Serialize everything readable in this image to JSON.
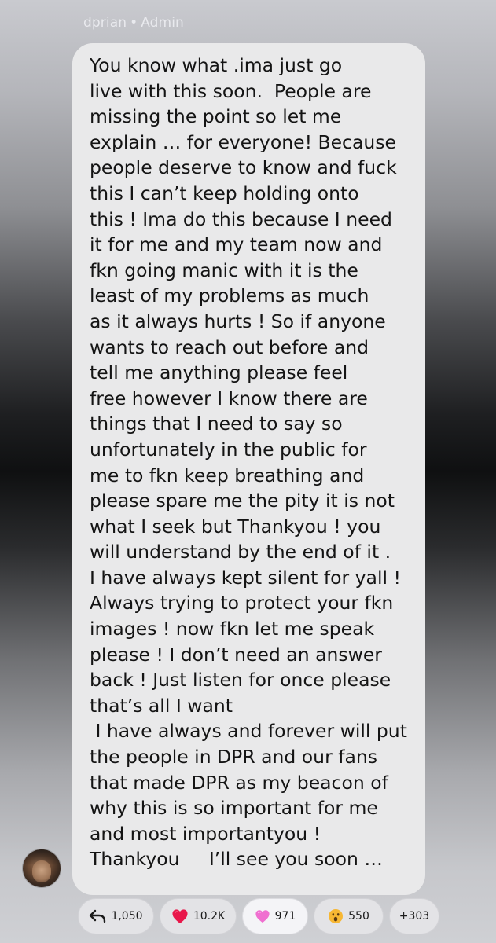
{
  "message": {
    "sender_name": "dprian",
    "separator": "•",
    "sender_role": "Admin",
    "lines": [
      "You know what .ima just go",
      "live with this soon.  People are",
      "missing the point so let me",
      "explain … for everyone! Because",
      "people deserve to know and fuck",
      "this I can’t keep holding onto",
      "this ! Ima do this because I need",
      "it for me and my team now and",
      "fkn going manic with it is the",
      "least of my problems as much",
      "as it always hurts ! So if anyone",
      "wants to reach out before and",
      "tell me anything please feel",
      "free however I know there are",
      "things that I need to say so",
      "unfortunately in the public for",
      "me to fkn keep breathing and",
      "please spare me the pity it is not",
      "what I seek but Thankyou ! you",
      "will understand by the end of it .",
      "I have always kept silent for yall !",
      "Always trying to protect your fkn",
      "images ! now fkn let me speak",
      "please ! I don’t need an answer",
      "back ! Just listen for once please",
      "that’s all I want",
      " I have always and forever will put",
      "the people in DPR and our fans",
      "that made DPR as my beacon of",
      "why this is so important for me",
      "and most importantyou !",
      "Thankyou     I’ll see you soon …"
    ]
  },
  "reactions": {
    "reply": {
      "icon": "reply-arrow-icon",
      "count": "1,050"
    },
    "heart": {
      "icon": "red-heart-icon",
      "count": "10.2K",
      "color": "#e8174a"
    },
    "pink_heart": {
      "icon": "pink-heart-icon",
      "count": "971",
      "color": "#f06fd0",
      "selected": true
    },
    "wow": {
      "icon": "surprised-face-icon",
      "count": "550",
      "color": "#f7b733"
    },
    "more": {
      "label": "+303"
    }
  }
}
